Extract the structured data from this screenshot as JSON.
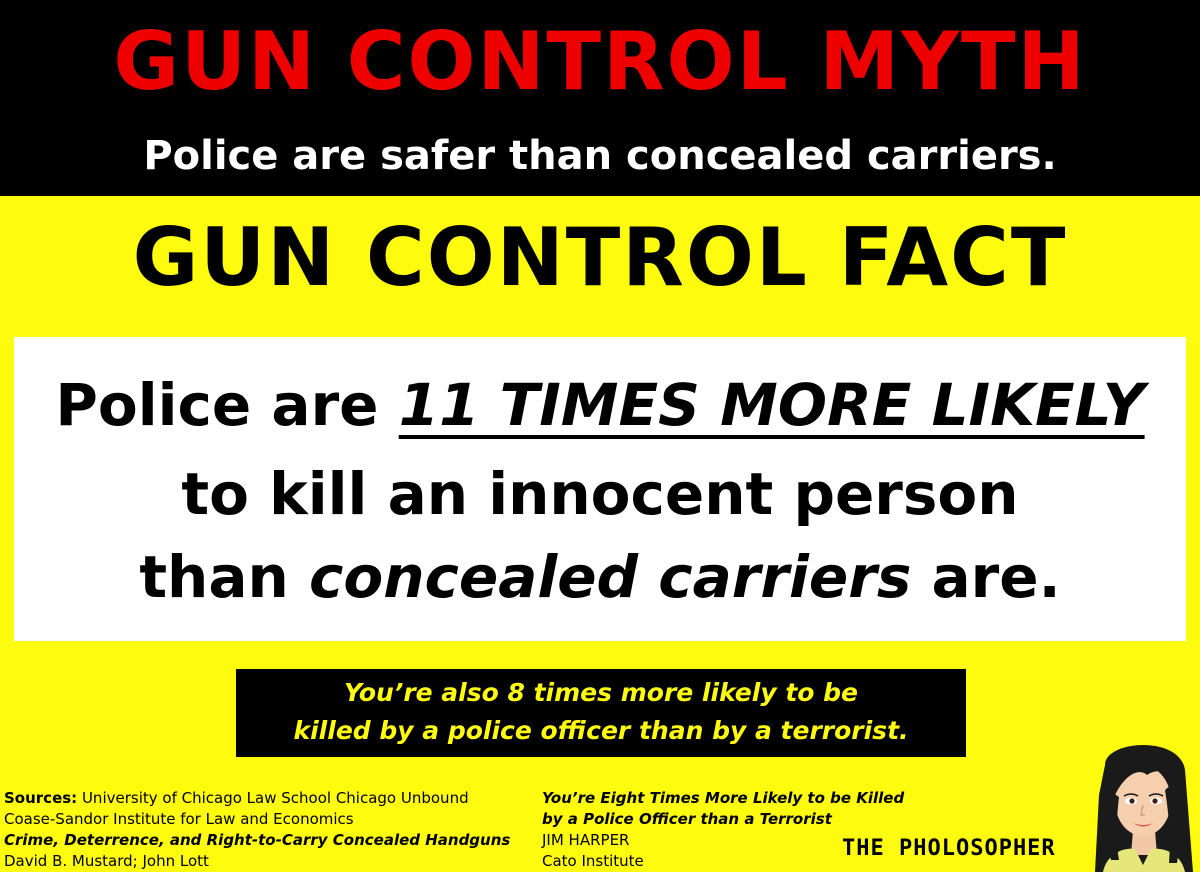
{
  "myth": {
    "title": "GUN CONTROL MYTH",
    "subtitle": "Police are safer than concealed carriers."
  },
  "fact": {
    "title": "GUN CONTROL FACT",
    "line1_prefix": "Police are ",
    "line1_emphasis": "11 TIMES MORE LIKELY",
    "line2": "to kill an innocent person",
    "line3_prefix": "than ",
    "line3_emphasis": "concealed carriers",
    "line3_suffix": " are."
  },
  "note": {
    "line1": "You’re also 8 times more likely to be",
    "line2": "killed by a police officer than by a terrorist."
  },
  "sources": {
    "label": "Sources:",
    "left": {
      "line1": " University of Chicago Law School Chicago Unbound",
      "line2": "Coase-Sandor Institute for Law and Economics",
      "line3": "Crime, Deterrence, and Right-to-Carry Concealed Handguns",
      "line4": "David B. Mustard; John Lott"
    },
    "right": {
      "line1": "You’re Eight Times More Likely to be Killed",
      "line2": "by a Police Officer than a Terrorist",
      "line3": "JIM HARPER",
      "line4": "Cato Institute"
    }
  },
  "branding": "THE PHOLOSOPHER",
  "colors": {
    "background": "#fffb0f",
    "myth_band": "#000000",
    "myth_title": "#ee0000",
    "note_text": "#fffb0f"
  }
}
